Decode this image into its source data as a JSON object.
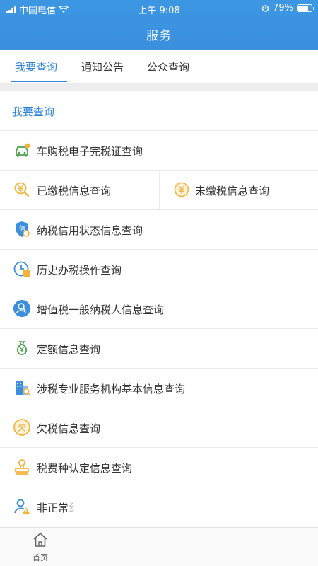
{
  "status_bar": {
    "carrier": "中国电信",
    "time": "上午 9:08",
    "battery": "79%"
  },
  "nav": {
    "title": "服务"
  },
  "tabs": [
    {
      "label": "我要查询",
      "active": true
    },
    {
      "label": "通知公告",
      "active": false
    },
    {
      "label": "公众查询",
      "active": false
    }
  ],
  "section": {
    "title": "我要查询"
  },
  "items": [
    {
      "label": "车购税电子完税证查询",
      "icon": "car-icon"
    },
    {
      "label": "已缴税信息查询",
      "icon": "yuan-search-icon"
    },
    {
      "label": "未缴税信息查询",
      "icon": "yuan-coin-icon"
    },
    {
      "label": "纳税信用状态信息查询",
      "icon": "credit-shield-icon"
    },
    {
      "label": "历史办税操作查询",
      "icon": "clock-tax-icon"
    },
    {
      "label": "增值税一般纳税人信息查询",
      "icon": "person-circle-icon"
    },
    {
      "label": "定额信息查询",
      "icon": "money-bag-icon"
    },
    {
      "label": "涉税专业服务机构基本信息查询",
      "icon": "building-search-icon"
    },
    {
      "label": "欠税信息查询",
      "icon": "owe-tax-icon"
    },
    {
      "label": "税费种认定信息查询",
      "icon": "stamp-icon"
    },
    {
      "label": "非正常纟",
      "icon": "person-warning-icon"
    }
  ],
  "bottom_nav": {
    "home_label": "首页"
  },
  "colors": {
    "primary": "#3b8fdd",
    "accent": "#f5b23a",
    "text": "#333333"
  }
}
